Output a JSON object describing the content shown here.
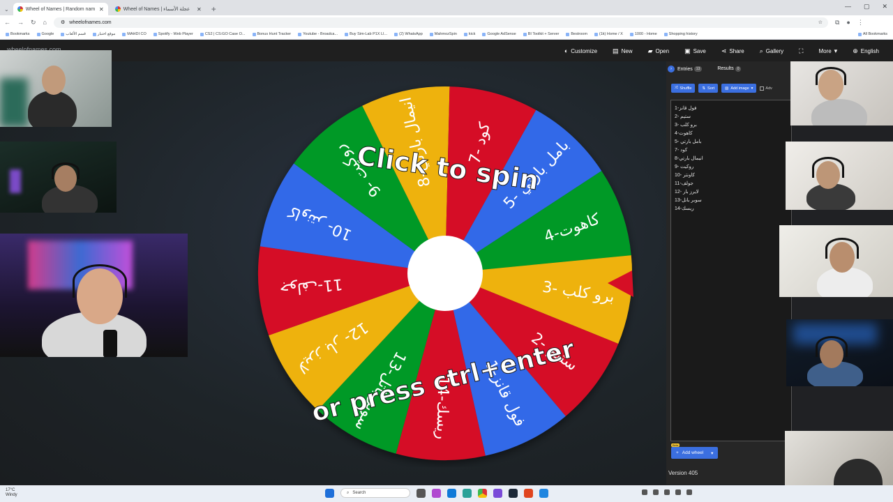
{
  "browser": {
    "tabs": [
      {
        "title": "Wheel of Names | Random nam",
        "active": true
      },
      {
        "title": "Wheel of Names | عجلة الأسماء",
        "active": false
      }
    ],
    "url": "wheelofnames.com",
    "bookmarks": [
      "Bookmarks",
      "Google",
      "قسم الألعاب",
      "موقع اختبار",
      "MAHDI CO",
      "Spotify - Web Player",
      "CS2 | CS:GO Case O...",
      "Bonus Hunt Tracker",
      "Youtube - Broadca...",
      "Buy Sim-Lab P1X LI...",
      "(2) WhatsApp",
      "MahmozSpin",
      "kick",
      "Google AdSense",
      "BI Toolkit + Server",
      "Bestroom",
      "(1k) Home / X",
      "1000 - Home",
      "Shopping history"
    ],
    "all_bookmarks": "All Bookmarks"
  },
  "app": {
    "logo": "wheelofnames.com",
    "menu": [
      {
        "label": "Customize",
        "icon": "palette-icon"
      },
      {
        "label": "New",
        "icon": "new-file-icon"
      },
      {
        "label": "Open",
        "icon": "folder-icon"
      },
      {
        "label": "Save",
        "icon": "save-icon"
      },
      {
        "label": "Share",
        "icon": "share-icon"
      },
      {
        "label": "Gallery",
        "icon": "search-icon"
      },
      {
        "label": "",
        "icon": "fullscreen-icon"
      },
      {
        "label": "More",
        "icon": "chevron-down-icon"
      },
      {
        "label": "English",
        "icon": "globe-icon"
      }
    ],
    "wheel": {
      "line1": "Click to spin",
      "line2": "or press ctrl+enter",
      "slices": [
        {
          "label": "فول قانز-1",
          "color": "#3369e8"
        },
        {
          "label": "ستيم -2",
          "color": "#d50f25"
        },
        {
          "label": "برو كلب -3",
          "color": "#eeb211"
        },
        {
          "label": "كاهوت-4",
          "color": "#009925"
        },
        {
          "label": "بامل بارتي -5",
          "color": "#3369e8"
        },
        {
          "label": "كود -7",
          "color": "#d50f25"
        },
        {
          "label": "انيمال بارتي-8",
          "color": "#eeb211"
        },
        {
          "label": "روكيت -9",
          "color": "#009925"
        },
        {
          "label": "كاونتر -10",
          "color": "#3369e8"
        },
        {
          "label": "جولف-11",
          "color": "#d50f25"
        },
        {
          "label": "لايرز بار -12",
          "color": "#eeb211"
        },
        {
          "label": "سوبر باتل-13",
          "color": "#009925"
        },
        {
          "label": "ريسك-14",
          "color": "#d50f25"
        }
      ]
    },
    "panel": {
      "entries_tab": "Entries",
      "entries_count": "13",
      "results_tab": "Results",
      "results_count": "0",
      "shuffle": "Shuffle",
      "sort": "Sort",
      "add_image": "Add image",
      "advanced": "Adv",
      "entries": [
        "فول قانز-1",
        "ستيم -2",
        "برو كلب -3",
        "كاهوت-4",
        "بامل بارتي -5",
        "كود -7",
        "انيمال بارتي-8",
        "روكيت -9",
        "كاونتر -10",
        "جولف-11",
        "لايرز بار -12",
        "سوبر باتل-13",
        "ريسك-14"
      ],
      "beta": "Beta",
      "add_wheel": "Add wheel",
      "version": "Version 405"
    }
  },
  "taskbar": {
    "temp": "17°C",
    "weather": "Windy",
    "search": "Search"
  }
}
